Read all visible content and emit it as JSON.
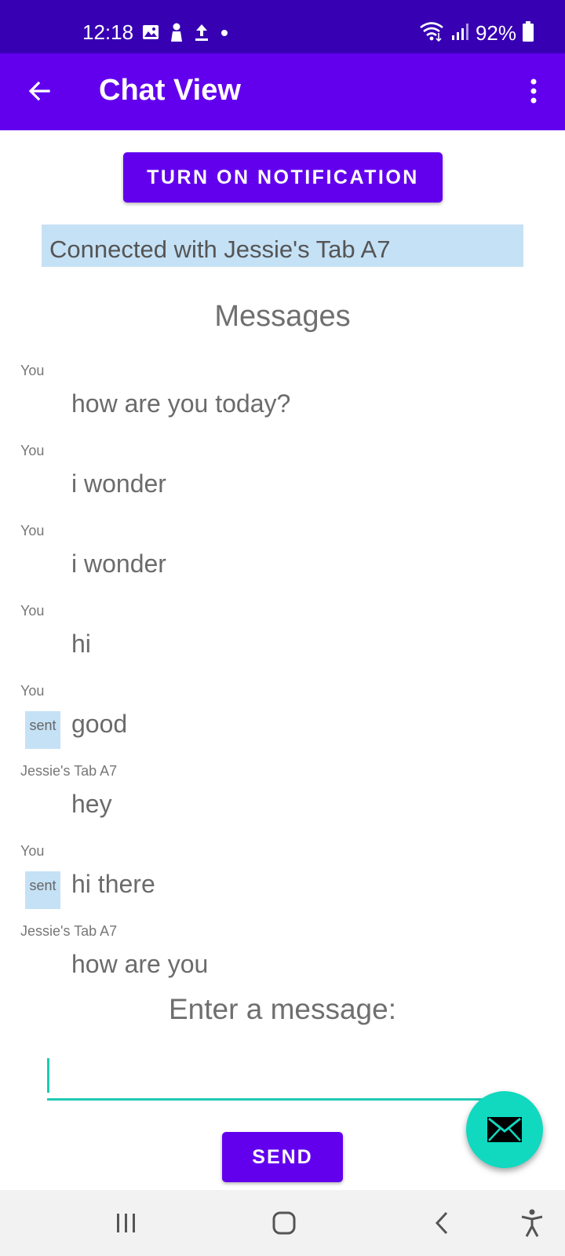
{
  "status_bar": {
    "time": "12:18",
    "battery": "92%",
    "left_icons": [
      "image-icon",
      "person-icon",
      "upload-icon",
      "dot-icon"
    ],
    "right_icons": [
      "wifi-icon",
      "signal-icon",
      "battery-icon"
    ]
  },
  "app_bar": {
    "title": "Chat View",
    "back_icon": "arrow-back-icon",
    "menu_icon": "more-vert-icon"
  },
  "notification_button": {
    "label": "TURN ON NOTIFICATION"
  },
  "connection": {
    "text": "Connected with Jessie's Tab A7"
  },
  "messages": {
    "heading": "Messages",
    "items": [
      {
        "sender": "You",
        "text": "how are you today?",
        "status": ""
      },
      {
        "sender": "You",
        "text": "i wonder",
        "status": ""
      },
      {
        "sender": "You",
        "text": "i wonder",
        "status": ""
      },
      {
        "sender": "You",
        "text": "hi",
        "status": ""
      },
      {
        "sender": "You",
        "text": "good",
        "status": "sent"
      },
      {
        "sender": "Jessie's Tab A7",
        "text": "hey",
        "status": ""
      },
      {
        "sender": "You",
        "text": "hi there",
        "status": "sent"
      },
      {
        "sender": "Jessie's Tab A7",
        "text": "how are you",
        "status": ""
      }
    ]
  },
  "composer": {
    "label": "Enter a message:",
    "value": "",
    "placeholder": "",
    "send_label": "SEND"
  },
  "fab": {
    "icon": "email-icon"
  },
  "nav_bar": {
    "items": [
      "recent-apps-icon",
      "home-icon",
      "back-icon",
      "accessibility-icon"
    ]
  },
  "colors": {
    "status_bar": "#3700b3",
    "primary": "#6200ee",
    "accent": "#10d9c0",
    "highlight": "#c5e1f5"
  }
}
